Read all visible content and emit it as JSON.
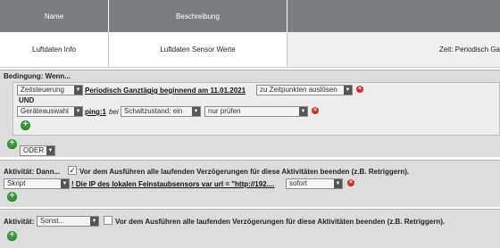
{
  "table": {
    "headers": [
      "Name",
      "Beschreibung",
      ""
    ],
    "row": {
      "name": "Luftdaten Info",
      "beschreibung": "Luftdaten Sensor Werte",
      "zeit": "Zeit: Periodisch Ga"
    }
  },
  "condition": {
    "label": "Bedingung: Wenn...",
    "rule1": {
      "type_select": "Zeitsteuerung",
      "desc": "Periodisch Ganztägig beginnend am 11.01.2021",
      "trigger_select": "zu Zeitpunkten auslösen"
    },
    "und": "UND",
    "rule2": {
      "type_select": "Geräteauswahl",
      "device": "ping:1",
      "bei": "bei",
      "state_select": "Schaltzustand: ein",
      "check_select": "nur prüfen"
    },
    "oder_select": "ODER"
  },
  "activity": {
    "label": "Aktivität: Dann...",
    "checkbox_checked": true,
    "checkbox_text": "Vor dem Ausführen alle laufenden Verzögerungen für diese Aktivitäten beenden (z.B. Retriggern).",
    "script_select": "Skript",
    "script_text": "! Die IP des lokalen Feinstaubsensors var url = \"http://192....",
    "timing_select": "sofort"
  },
  "else_activity": {
    "label_prefix": "Aktivität:",
    "sonst_select": "Sonst...",
    "checkbox_checked": false,
    "checkbox_text": "Vor dem Ausführen alle laufenden Verzögerungen für diese Aktivitäten beenden (z.B. Retriggern)."
  },
  "icons": {
    "remove": "remove-icon",
    "add": "add-icon",
    "dropdown": "chevron-down-icon",
    "check": "checkmark-icon"
  },
  "colors": {
    "header_bg": "#7b7d80",
    "panel_bg": "#dcdcdc",
    "add_green": "#2e9e2e",
    "remove_red": "#d42a2a"
  }
}
